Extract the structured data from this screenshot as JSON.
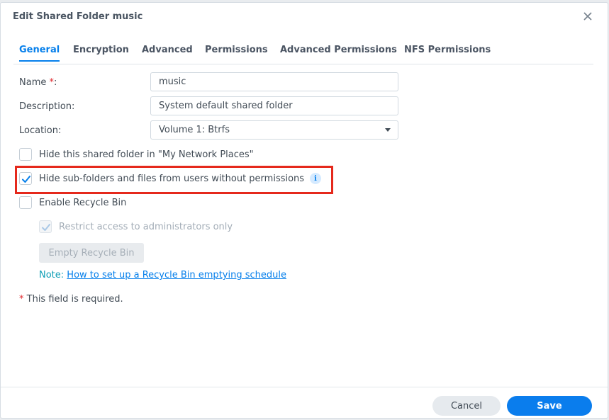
{
  "dialog": {
    "title": "Edit Shared Folder music",
    "close_icon": "close-icon"
  },
  "tabs": [
    {
      "label": "General",
      "active": true
    },
    {
      "label": "Encryption",
      "active": false
    },
    {
      "label": "Advanced",
      "active": false
    },
    {
      "label": "Permissions",
      "active": false
    },
    {
      "label": "Advanced Permissions",
      "active": false
    },
    {
      "label": "NFS Permissions",
      "active": false
    }
  ],
  "form": {
    "name_label": "Name",
    "name_required_mark": "*",
    "name_colon": ":",
    "name_value": "music",
    "description_label": "Description:",
    "description_value": "System default shared folder",
    "location_label": "Location:",
    "location_value": "Volume 1:  Btrfs"
  },
  "options": {
    "hide_network_places": {
      "label": "Hide this shared folder in \"My Network Places\"",
      "checked": false
    },
    "hide_subfolders": {
      "label": "Hide sub-folders and files from users without permissions",
      "checked": true,
      "info_icon": "info-icon",
      "info_glyph": "i"
    },
    "recycle_bin": {
      "label": "Enable Recycle Bin",
      "checked": false
    },
    "restrict_admin": {
      "label": "Restrict access to administrators only",
      "checked": true,
      "disabled": true
    }
  },
  "recycle": {
    "empty_button": "Empty Recycle Bin",
    "note_prefix": "Note:",
    "note_link": "How to set up a Recycle Bin emptying schedule"
  },
  "required_note": {
    "mark": "*",
    "text": " This field is required."
  },
  "footer": {
    "cancel_label": "Cancel",
    "save_label": "Save"
  },
  "colors": {
    "accent": "#057feb",
    "highlight": "#e5291c",
    "required": "#e0282e"
  }
}
